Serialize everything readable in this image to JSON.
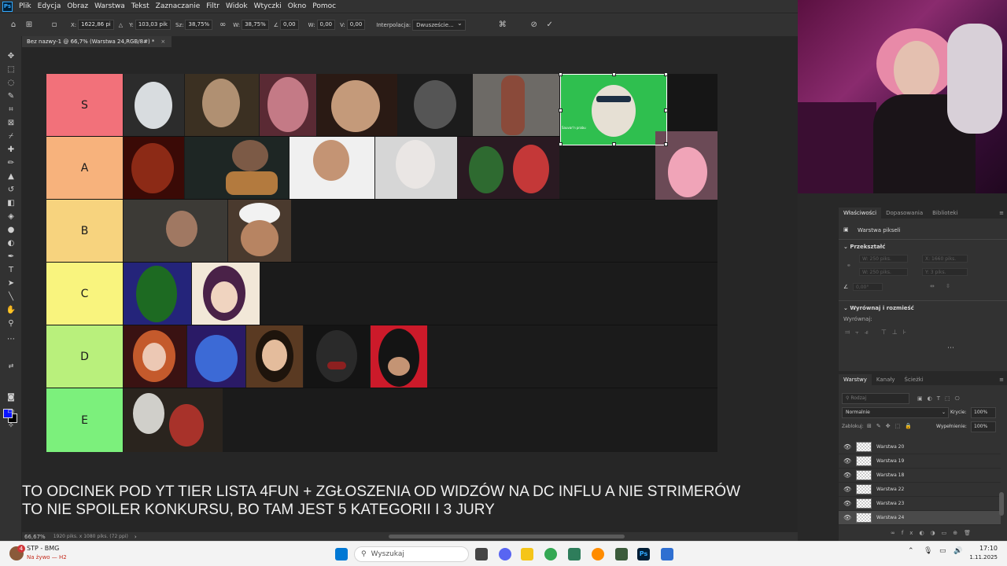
{
  "menu": {
    "items": [
      "Plik",
      "Edycja",
      "Obraz",
      "Warstwa",
      "Tekst",
      "Zaznaczanie",
      "Filtr",
      "Widok",
      "Wtyczki",
      "Okno",
      "Pomoc"
    ]
  },
  "options": {
    "x_label": "X:",
    "x_value": "1622,86 pi",
    "y_label": "Y:",
    "y_value": "103,03 pik",
    "w_label": "Sz:",
    "w_value": "38,75%",
    "h_label": "W:",
    "h_value": "38,75%",
    "angle_value": "0,00",
    "hskew_label": "W:",
    "hskew_value": "0,00",
    "vskew_label": "V:",
    "vskew_value": "0,00",
    "interp_label": "Interpolacja:",
    "interp_value": "Dwuszeście..."
  },
  "document": {
    "tab_title": "Bez nazwy-1 @ 66,7% (Warstwa 24,RGB/8#) *",
    "zoom": "66,67%",
    "doc_info": "1920 piks. x 1080 piks. (72 ppi)"
  },
  "tiers": [
    {
      "label": "S",
      "color": "#f2717a"
    },
    {
      "label": "A",
      "color": "#f7b27c"
    },
    {
      "label": "B",
      "color": "#f7d37e"
    },
    {
      "label": "C",
      "color": "#f9f47e"
    },
    {
      "label": "D",
      "color": "#b9f07c"
    },
    {
      "label": "E",
      "color": "#7cf07c"
    }
  ],
  "selected_layer_label": "Sauvar'n prabu",
  "caption": {
    "line1": "TO ODCINEK POD YT TIER LISTA 4FUN + ZGŁOSZENIA OD WIDZÓW NA DC INFLU A NIE STRIMERÓW",
    "line2": "TO NIE SPOILER KONKURSU, BO TAM JEST 5 KATEGORII I 3 JURY"
  },
  "properties_panel": {
    "tabs": [
      "Właściwości",
      "Dopasowania",
      "Biblioteki"
    ],
    "layer_type": "Warstwa pikseli",
    "transform_title": "Przekształć",
    "w_field": "W: 250 piks.",
    "x_field": "X: 1660 piks.",
    "h_field": "W: 250 piks.",
    "y_field": "Y: 3 piks.",
    "angle_field": "0,00°",
    "align_title": "Wyrównaj i rozmieść",
    "align_label": "Wyrównaj:"
  },
  "layers_panel": {
    "tabs": [
      "Warstwy",
      "Kanały",
      "Ścieżki"
    ],
    "filter_placeholder": "Rodzaj",
    "blend_mode": "Normalnie",
    "opacity_label": "Krycie:",
    "opacity_value": "100%",
    "lock_label": "Zablokuj:",
    "fill_label": "Wypełnienie:",
    "fill_value": "100%",
    "layers": [
      {
        "name": "Warstwa 20"
      },
      {
        "name": "Warstwa 19"
      },
      {
        "name": "Warstwa 18"
      },
      {
        "name": "Warstwa 22"
      },
      {
        "name": "Warstwa 23"
      },
      {
        "name": "Warstwa 24"
      }
    ]
  },
  "taskbar": {
    "app_name": "STP - BMG",
    "app_status": "Na żywo — H2",
    "notif_count": "4",
    "search_placeholder": "Wyszukaj",
    "time": "17:10",
    "date": "1.11.2025"
  }
}
